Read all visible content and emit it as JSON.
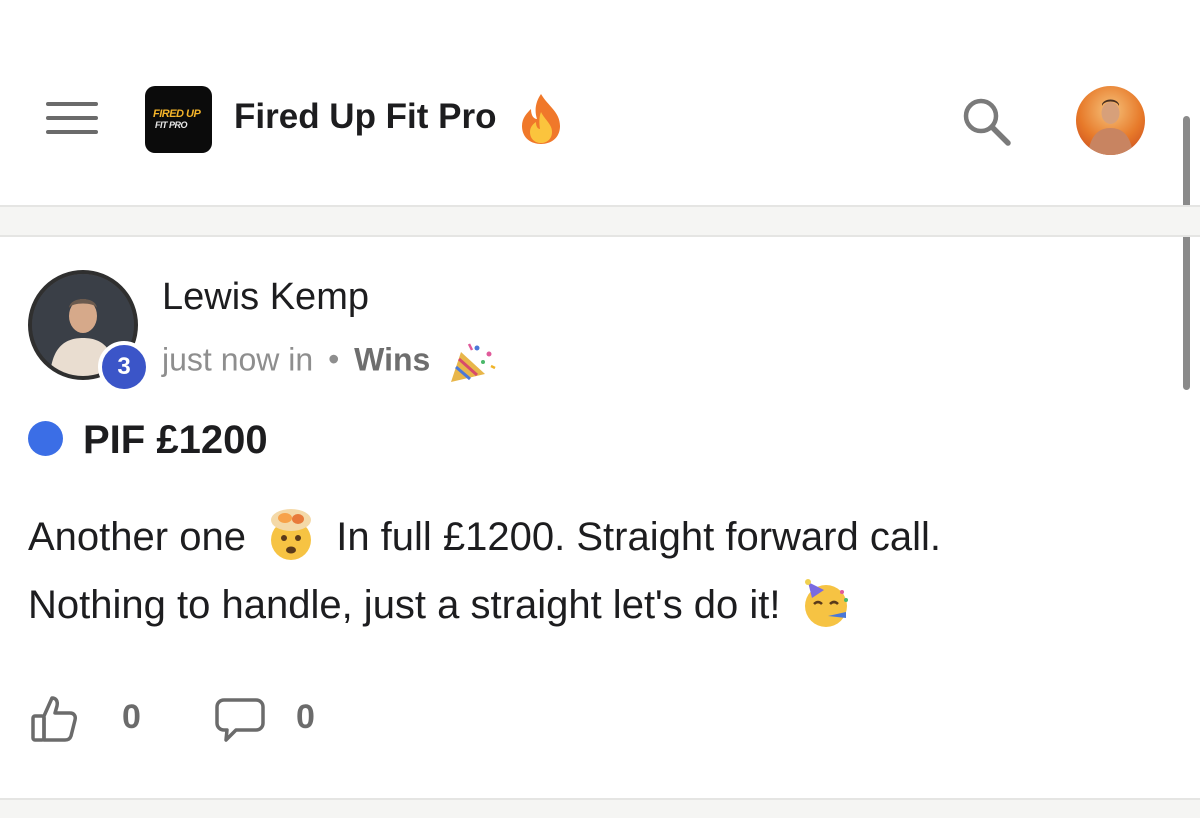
{
  "header": {
    "logo_line1": "FIRED UP",
    "logo_line2": "FIT PRO",
    "title": "Fired Up Fit Pro",
    "title_icon": "fire-emoji",
    "search_icon": "search-icon",
    "menu_icon": "hamburger-menu-icon"
  },
  "post": {
    "author": "Lewis Kemp",
    "level": "3",
    "time": "just now in",
    "separator": "•",
    "category": "Wins",
    "category_icon": "party-popper-emoji",
    "title": "PIF £1200",
    "body_part1": "Another one",
    "body_part2": "In full £1200. Straight forward call.",
    "body_part3": "Nothing to handle, just a straight let's do it!",
    "likes": "0",
    "comments": "0"
  },
  "colors": {
    "accent_blue": "#3b6ee6",
    "badge_blue": "#3b55c8",
    "muted_text": "#8e8e8e"
  }
}
